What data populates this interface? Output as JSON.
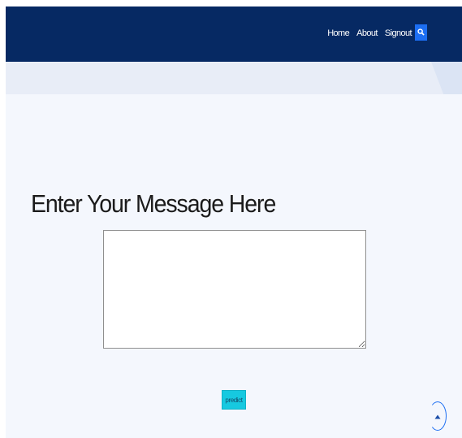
{
  "navbar": {
    "links": [
      "Home",
      "About",
      "Signout"
    ],
    "search_icon": "search-icon"
  },
  "main": {
    "heading": "Enter Your Message Here",
    "message_value": "",
    "predict_label": "predict",
    "scroll_top_icon": "chevron-up-icon"
  },
  "colors": {
    "navbar": "#062963",
    "accent": "#1c6ef2",
    "predict_button": "#16c9e0",
    "background": "#f4f7fd"
  }
}
